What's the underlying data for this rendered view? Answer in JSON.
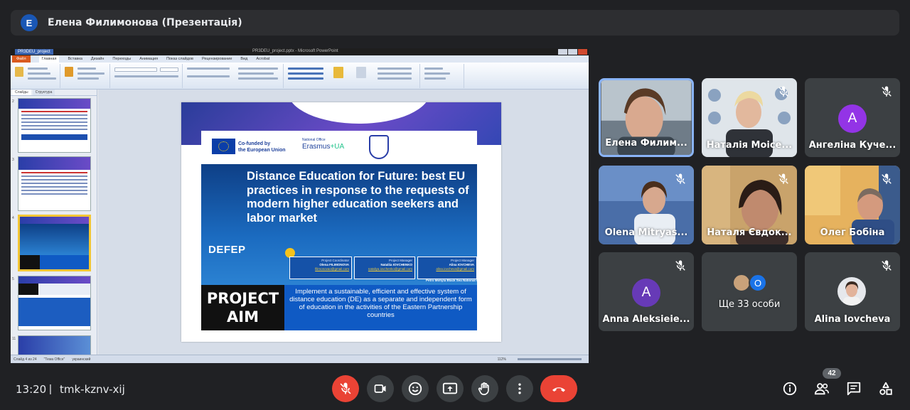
{
  "header": {
    "avatar_letter": "E",
    "title": "Елена Филимонова (Презентація)"
  },
  "share": {
    "pp_document_tab": "PR3DEU_project",
    "pp_window_title": "PR3DEU_project.pptx - Microsoft PowerPoint",
    "ribbon_tabs": [
      "Файл",
      "Главная",
      "Вставка",
      "Дизайн",
      "Переходы",
      "Анимация",
      "Показ слайдов",
      "Рецензирование",
      "Вид",
      "Acrobat"
    ],
    "left_panel_tabs": [
      "Слайды",
      "Структура"
    ],
    "slide_numbers": [
      "2",
      "3",
      "4",
      "5",
      "11"
    ],
    "status_text": "Слайд 4 из 24",
    "status_theme": "\"Тема Office\"",
    "status_lang": "украинский",
    "zoom": "112%"
  },
  "slide": {
    "cofunded": "Co-funded by\nthe European Union",
    "national_office": "National Office",
    "erasmus_left": "Erasmus",
    "erasmus_right": "+UA",
    "title": "Distance Education for Future: best EU practices in response to the  requests of modern higher education seekers and labor market",
    "acronym": "DEFEP",
    "managers": [
      {
        "role": "Project Coordinator",
        "name": "Olena FILIMONOVA",
        "email": "filimonovao@gmail.com"
      },
      {
        "role": "Project Manager",
        "name": "Nataliia IOVCHENKO",
        "email": "nataliya.iovchenko@gmail.com"
      },
      {
        "role": "Project Manager",
        "name": "Alina IOVCHEVA",
        "email": "alina.iovcheva@gmail.com"
      }
    ],
    "university": "Petro Mohyla Black Sea National University",
    "aim_label_1": "PROJECT",
    "aim_label_2": "AIM",
    "aim_text": "Implement a sustainable, efficient and effective system of distance education (DE) as a separate and independent form of education in the activities of the Eastern Partnership countries"
  },
  "participants": [
    {
      "name": "Елена Филим...",
      "muted": false,
      "kind": "video"
    },
    {
      "name": "Наталія Моісе...",
      "muted": true,
      "kind": "video"
    },
    {
      "name": "Ангеліна Куче...",
      "muted": true,
      "kind": "avatar",
      "letter": "А",
      "color": "#9334e6"
    },
    {
      "name": "Olena Mitryas...",
      "muted": true,
      "kind": "video"
    },
    {
      "name": "Наталя Євдок...",
      "muted": true,
      "kind": "video"
    },
    {
      "name": "Олег Бобіна",
      "muted": true,
      "kind": "video"
    },
    {
      "name": "Anna Aleksieie...",
      "muted": true,
      "kind": "avatar",
      "letter": "A",
      "color": "#673ab7"
    },
    {
      "name": "Ще 33 особи",
      "muted": false,
      "kind": "more",
      "badge": "O"
    },
    {
      "name": "Alina Iovcheva",
      "muted": true,
      "kind": "photo"
    }
  ],
  "footer": {
    "time": "13:20",
    "separator": "|",
    "meeting_code": "tmk-kznv-xij",
    "participant_count": "42"
  },
  "colors": {
    "end_call": "#ea4335",
    "mic_off": "#ea4335",
    "active_speaker": "#8ab4f8"
  }
}
